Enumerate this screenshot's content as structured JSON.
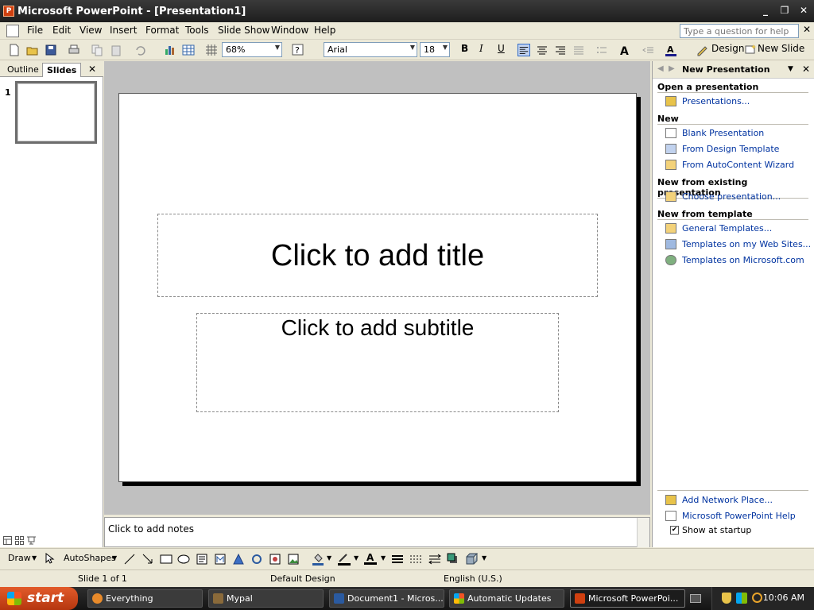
{
  "window": {
    "title": "Microsoft PowerPoint - [Presentation1]",
    "minimize": "_",
    "restore": "❐",
    "close": "✕"
  },
  "menu": {
    "items": [
      "File",
      "Edit",
      "View",
      "Insert",
      "Format",
      "Tools",
      "Slide Show",
      "Window",
      "Help"
    ],
    "help_placeholder": "Type a question for help",
    "doc_close": "✕"
  },
  "toolbar": {
    "zoom": "68%",
    "font": "Arial",
    "font_size": "18",
    "bold": "B",
    "italic": "I",
    "underline": "U",
    "design_label": "Design",
    "new_slide_label": "New Slide"
  },
  "left_pane": {
    "tabs": [
      "Outline",
      "Slides"
    ],
    "active_tab": "Slides",
    "close": "✕",
    "slide_number": "1"
  },
  "slide": {
    "title_placeholder": "Click to add title",
    "subtitle_placeholder": "Click to add subtitle"
  },
  "notes": {
    "placeholder": "Click to add notes"
  },
  "task_pane": {
    "title": "New Presentation",
    "close": "✕",
    "sections": [
      {
        "heading": "Open a presentation",
        "links": [
          "Presentations..."
        ]
      },
      {
        "heading": "New",
        "links": [
          "Blank Presentation",
          "From Design Template",
          "From AutoContent Wizard"
        ]
      },
      {
        "heading": "New from existing presentation",
        "links": [
          "Choose presentation..."
        ]
      },
      {
        "heading": "New from template",
        "links": [
          "General Templates...",
          "Templates on my Web Sites...",
          "Templates on Microsoft.com"
        ]
      }
    ],
    "bottom_links": [
      "Add Network Place...",
      "Microsoft PowerPoint Help"
    ],
    "show_at_startup": "Show at startup",
    "show_at_startup_checked": true
  },
  "draw_bar": {
    "draw_label": "Draw",
    "autoshapes_label": "AutoShapes"
  },
  "status_bar": {
    "slide_info": "Slide 1 of 1",
    "design": "Default Design",
    "language": "English (U.S.)"
  },
  "taskbar": {
    "start_label": "start",
    "tasks": [
      "Everything",
      "Mypal",
      "Document1 - Micros...",
      "Automatic Updates",
      "Microsoft PowerPoi..."
    ],
    "active_task": "Microsoft PowerPoi...",
    "clock": "10:06 AM"
  },
  "colors": {
    "link": "#0033a0",
    "title_bar": "#1e1e1e",
    "start": "#c8431a",
    "workspace": "#c0c0c0"
  }
}
